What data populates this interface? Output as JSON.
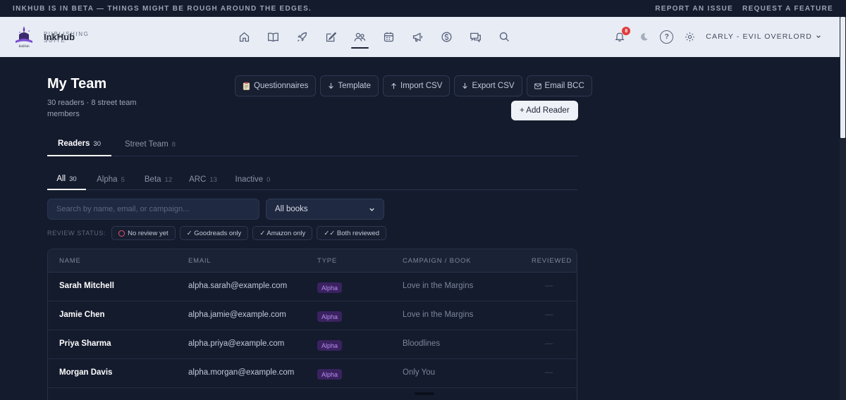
{
  "beta_bar": {
    "message": "INKHUB IS IN BETA — THINGS MIGHT BE ROUGH AROUND THE EDGES.",
    "report_link": "REPORT AN ISSUE",
    "feature_link": "REQUEST A FEATURE"
  },
  "brand": {
    "name": "InkHub",
    "subtitle": "PUBLISHING SUITE",
    "logo_text": "InkHub"
  },
  "nav": {
    "icons": [
      "home-icon",
      "book-icon",
      "rocket-icon",
      "edit-icon",
      "team-icon",
      "calendar-icon",
      "megaphone-icon",
      "dollar-icon",
      "chat-icon",
      "search-icon"
    ],
    "active": "team-icon"
  },
  "header": {
    "notifications_count": "8",
    "help_label": "?",
    "user_label": "CARLY - EVIL OVERLORD"
  },
  "page": {
    "title": "My Team",
    "subtitle": "30 readers · 8 street team members"
  },
  "actions": {
    "questionnaires": "Questionnaires",
    "template": "Template",
    "import_csv": "Import CSV",
    "export_csv": "Export CSV",
    "email_bcc": "Email BCC",
    "add_reader": "+ Add Reader"
  },
  "tabs": [
    {
      "label": "Readers",
      "count": "30"
    },
    {
      "label": "Street Team",
      "count": "8"
    }
  ],
  "subtabs": [
    {
      "label": "All",
      "count": "30"
    },
    {
      "label": "Alpha",
      "count": "5"
    },
    {
      "label": "Beta",
      "count": "12"
    },
    {
      "label": "ARC",
      "count": "13"
    },
    {
      "label": "Inactive",
      "count": "0"
    }
  ],
  "filters": {
    "search_placeholder": "Search by name, email, or campaign...",
    "book_select": "All books",
    "review_status_label": "REVIEW STATUS:",
    "chips": [
      "No review yet",
      "✓ Goodreads only",
      "✓ Amazon only",
      "✓✓ Both reviewed"
    ]
  },
  "table": {
    "headers": [
      "NAME",
      "EMAIL",
      "TYPE",
      "CAMPAIGN / BOOK",
      "REVIEWED"
    ],
    "rows": [
      {
        "name": "Sarah Mitchell",
        "email": "alpha.sarah@example.com",
        "type": "Alpha",
        "campaign": "Love in the Margins",
        "reviewed": "—"
      },
      {
        "name": "Jamie Chen",
        "email": "alpha.jamie@example.com",
        "type": "Alpha",
        "campaign": "Love in the Margins",
        "reviewed": "—"
      },
      {
        "name": "Priya Sharma",
        "email": "alpha.priya@example.com",
        "type": "Alpha",
        "campaign": "Bloodlines",
        "reviewed": "—"
      },
      {
        "name": "Morgan Davis",
        "email": "alpha.morgan@example.com",
        "type": "Alpha",
        "campaign": "Only You",
        "reviewed": "—"
      }
    ]
  },
  "colors": {
    "background": "#141b2d",
    "header_bg": "#e8ecf4",
    "badge_red": "#e23b3b",
    "alpha_badge_bg": "#3a2260",
    "alpha_badge_text": "#b88cf0"
  }
}
